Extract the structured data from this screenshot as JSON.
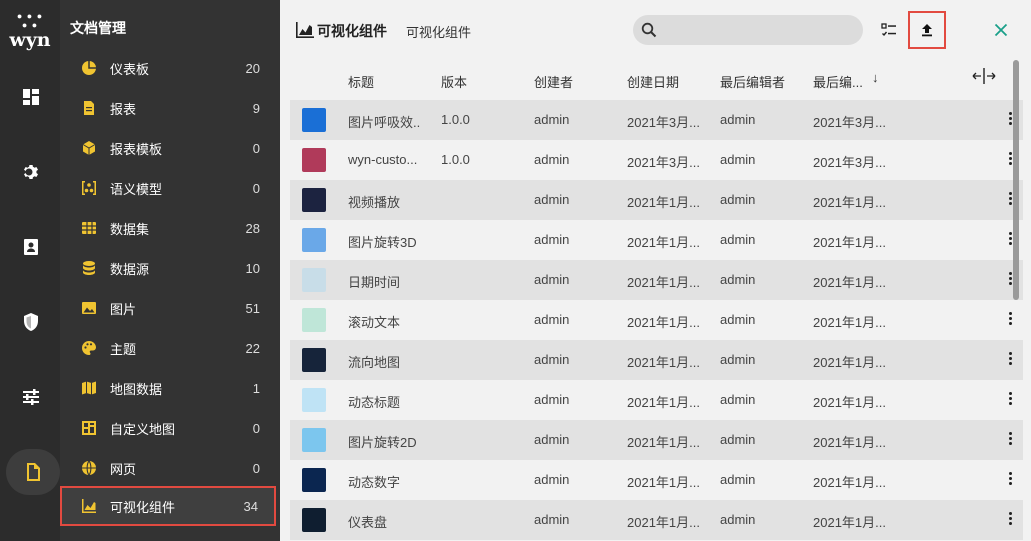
{
  "app": {
    "logo_text": "wyn"
  },
  "rail": {
    "items": [
      {
        "name": "dashboard-icon"
      },
      {
        "name": "gear-icon"
      },
      {
        "name": "contact-card-icon"
      },
      {
        "name": "shield-icon"
      },
      {
        "name": "sliders-icon"
      },
      {
        "name": "document-icon",
        "active": true
      }
    ]
  },
  "folders": {
    "title": "文档管理",
    "items": [
      {
        "label": "仪表板",
        "count": "20",
        "icon": "dashboard-pie-icon"
      },
      {
        "label": "报表",
        "count": "9",
        "icon": "report-icon"
      },
      {
        "label": "报表模板",
        "count": "0",
        "icon": "report-template-icon"
      },
      {
        "label": "语义模型",
        "count": "0",
        "icon": "semantic-model-icon"
      },
      {
        "label": "数据集",
        "count": "28",
        "icon": "dataset-icon"
      },
      {
        "label": "数据源",
        "count": "10",
        "icon": "datasource-icon"
      },
      {
        "label": "图片",
        "count": "51",
        "icon": "image-icon"
      },
      {
        "label": "主题",
        "count": "22",
        "icon": "palette-icon"
      },
      {
        "label": "地图数据",
        "count": "1",
        "icon": "map-icon"
      },
      {
        "label": "自定义地图",
        "count": "0",
        "icon": "custom-map-icon"
      },
      {
        "label": "网页",
        "count": "0",
        "icon": "globe-icon"
      },
      {
        "label": "可视化组件",
        "count": "34",
        "icon": "chart-area-icon",
        "selected": true
      }
    ]
  },
  "header": {
    "title": "可视化组件",
    "subtitle": "可视化组件",
    "search_placeholder": ""
  },
  "table": {
    "columns": [
      "标题",
      "版本",
      "创建者",
      "创建日期",
      "最后编辑者",
      "最后编..."
    ],
    "sort_indicator": "↓",
    "rows": [
      {
        "title": "图片呼吸效...",
        "version": "1.0.0",
        "creator": "admin",
        "created": "2021年3月...",
        "editor": "admin",
        "edited": "2021年3月...",
        "thumb": "#1a6fd6"
      },
      {
        "title": "wyn-custo...",
        "version": "1.0.0",
        "creator": "admin",
        "created": "2021年3月...",
        "editor": "admin",
        "edited": "2021年3月...",
        "thumb": "#b03a5a"
      },
      {
        "title": "视频播放",
        "version": "",
        "creator": "admin",
        "created": "2021年1月...",
        "editor": "admin",
        "edited": "2021年1月...",
        "thumb": "#1c2340"
      },
      {
        "title": "图片旋转3D",
        "version": "",
        "creator": "admin",
        "created": "2021年1月...",
        "editor": "admin",
        "edited": "2021年1月...",
        "thumb": "#6aa8e8"
      },
      {
        "title": "日期时间",
        "version": "",
        "creator": "admin",
        "created": "2021年1月...",
        "editor": "admin",
        "edited": "2021年1月...",
        "thumb": "#c8dde8"
      },
      {
        "title": "滚动文本",
        "version": "",
        "creator": "admin",
        "created": "2021年1月...",
        "editor": "admin",
        "edited": "2021年1月...",
        "thumb": "#bfe6d8"
      },
      {
        "title": "流向地图",
        "version": "",
        "creator": "admin",
        "created": "2021年1月...",
        "editor": "admin",
        "edited": "2021年1月...",
        "thumb": "#16243a"
      },
      {
        "title": "动态标题",
        "version": "",
        "creator": "admin",
        "created": "2021年1月...",
        "editor": "admin",
        "edited": "2021年1月...",
        "thumb": "#bfe3f5"
      },
      {
        "title": "图片旋转2D",
        "version": "",
        "creator": "admin",
        "created": "2021年1月...",
        "editor": "admin",
        "edited": "2021年1月...",
        "thumb": "#7cc6ee"
      },
      {
        "title": "动态数字",
        "version": "",
        "creator": "admin",
        "created": "2021年1月...",
        "editor": "admin",
        "edited": "2021年1月...",
        "thumb": "#0b2650"
      },
      {
        "title": "仪表盘",
        "version": "",
        "creator": "admin",
        "created": "2021年1月...",
        "editor": "admin",
        "edited": "2021年1月...",
        "thumb": "#0f1e30"
      }
    ]
  },
  "colors": {
    "accent": "#f0c431",
    "highlight": "#e24a40",
    "close": "#1aa08a"
  }
}
